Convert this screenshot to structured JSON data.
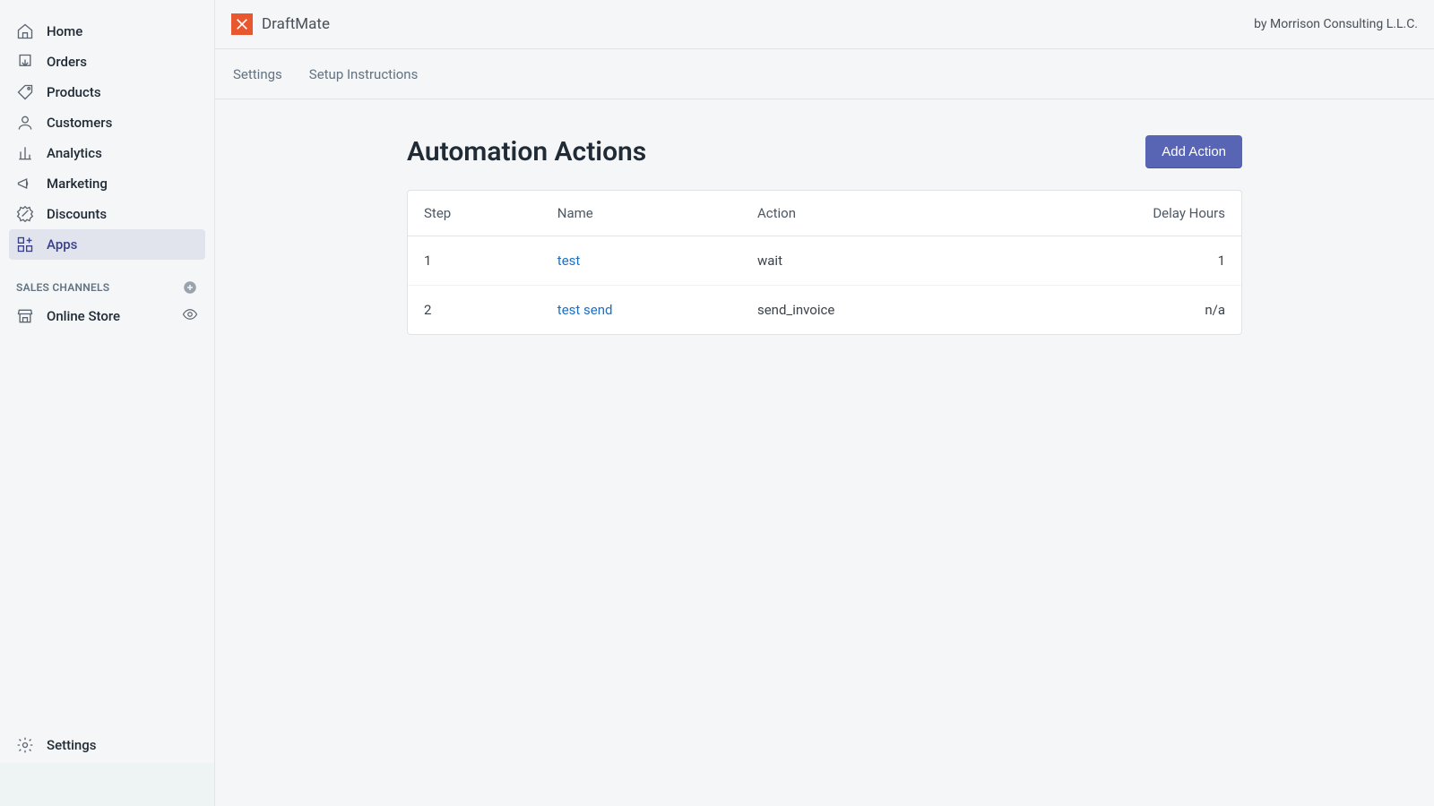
{
  "sidebar": {
    "nav": [
      {
        "label": "Home"
      },
      {
        "label": "Orders"
      },
      {
        "label": "Products"
      },
      {
        "label": "Customers"
      },
      {
        "label": "Analytics"
      },
      {
        "label": "Marketing"
      },
      {
        "label": "Discounts"
      },
      {
        "label": "Apps"
      }
    ],
    "sales_channels_header": "SALES CHANNELS",
    "channels": [
      {
        "label": "Online Store"
      }
    ],
    "settings_label": "Settings"
  },
  "topbar": {
    "app_name": "DraftMate",
    "by_line": "by Morrison Consulting L.L.C."
  },
  "subtabs": [
    {
      "label": "Settings"
    },
    {
      "label": "Setup Instructions"
    }
  ],
  "page": {
    "title": "Automation Actions",
    "add_button_label": "Add Action"
  },
  "table": {
    "headers": {
      "step": "Step",
      "name": "Name",
      "action": "Action",
      "delay": "Delay Hours"
    },
    "rows": [
      {
        "step": "1",
        "name": "test",
        "action": "wait",
        "delay": "1"
      },
      {
        "step": "2",
        "name": "test send",
        "action": "send_invoice",
        "delay": "n/a"
      }
    ]
  }
}
